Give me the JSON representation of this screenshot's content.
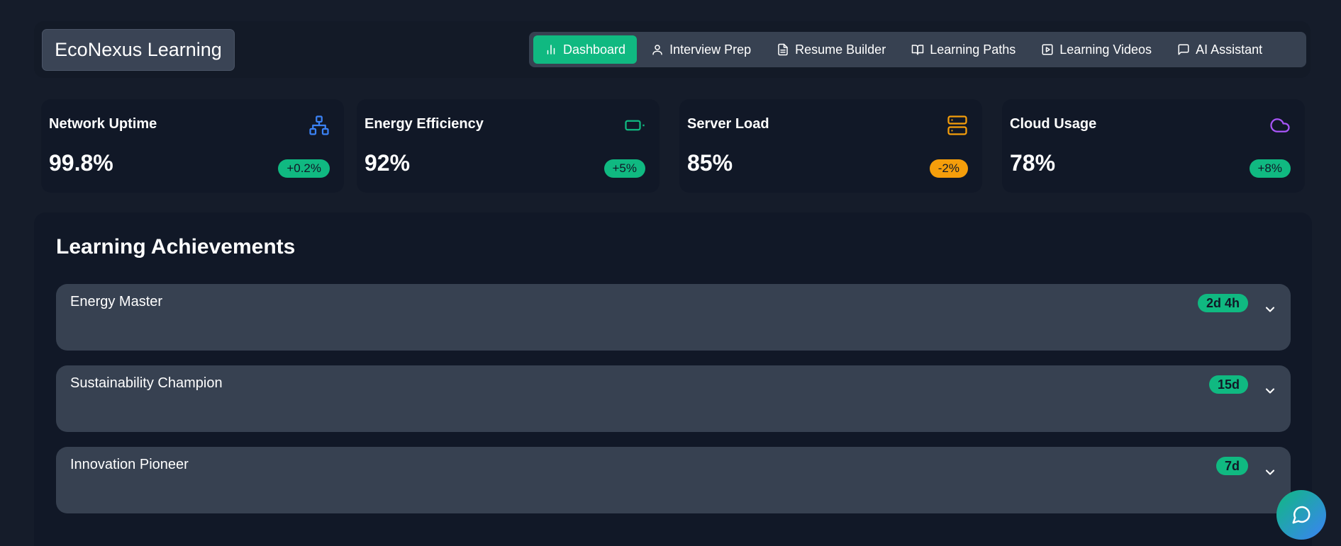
{
  "app": {
    "brand": "EcoNexus Learning"
  },
  "nav": [
    {
      "label": "Dashboard",
      "icon": "bar-chart-icon",
      "active": true
    },
    {
      "label": "Interview Prep",
      "icon": "user-icon",
      "active": false
    },
    {
      "label": "Resume Builder",
      "icon": "file-text-icon",
      "active": false
    },
    {
      "label": "Learning Paths",
      "icon": "book-open-icon",
      "active": false
    },
    {
      "label": "Learning Videos",
      "icon": "play-square-icon",
      "active": false
    },
    {
      "label": "AI Assistant",
      "icon": "message-square-icon",
      "active": false
    }
  ],
  "stats": [
    {
      "title": "Network Uptime",
      "value": "99.8%",
      "change": "+0.2%",
      "trend": "up",
      "icon": "network-icon",
      "icon_color": "#3b82f6"
    },
    {
      "title": "Energy Efficiency",
      "value": "92%",
      "change": "+5%",
      "trend": "up",
      "icon": "battery-icon",
      "icon_color": "#10b981"
    },
    {
      "title": "Server Load",
      "value": "85%",
      "change": "-2%",
      "trend": "down",
      "icon": "server-icon",
      "icon_color": "#f59e0b"
    },
    {
      "title": "Cloud Usage",
      "value": "78%",
      "change": "+8%",
      "trend": "up",
      "icon": "cloud-icon",
      "icon_color": "#a855f7"
    }
  ],
  "achievements": {
    "title": "Learning Achievements",
    "items": [
      {
        "name": "Energy Master",
        "time": "2d 4h"
      },
      {
        "name": "Sustainability Champion",
        "time": "15d"
      },
      {
        "name": "Innovation Pioneer",
        "time": "7d"
      }
    ]
  },
  "colors": {
    "accent": "#10b981",
    "warning": "#f59e0b",
    "background": "#151c2a",
    "card": "#111827"
  },
  "fab": {
    "icon": "chat-icon"
  }
}
